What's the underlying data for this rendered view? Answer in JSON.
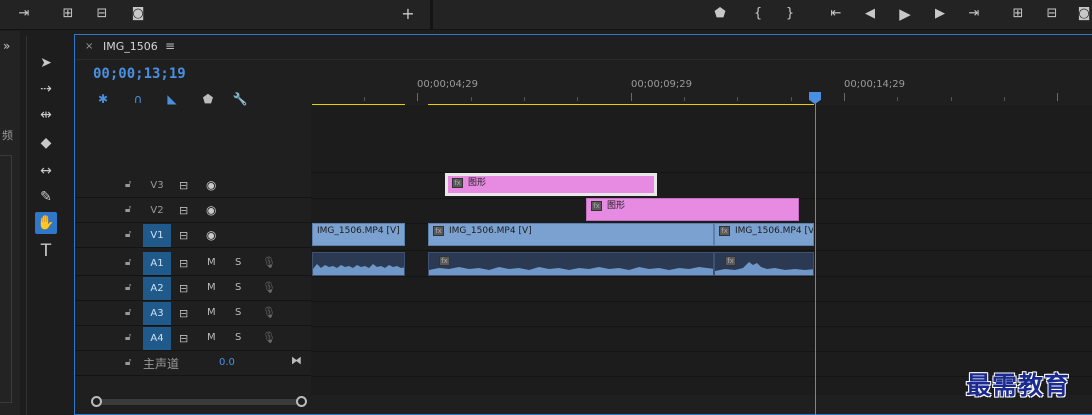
{
  "timeline": {
    "tab_close": "×",
    "sequence_name": "IMG_1506",
    "menu_icon": "≡",
    "timecode": "00;00;13;19"
  },
  "ruler": {
    "labels": [
      "00;00;04;29",
      "00;00;09;29",
      "00;00;14;29"
    ]
  },
  "left_strip": {
    "chevron": "»",
    "fragment": "频"
  },
  "tracks": {
    "video": [
      {
        "name": "V3"
      },
      {
        "name": "V2"
      },
      {
        "name": "V1"
      }
    ],
    "audio": [
      {
        "name": "A1",
        "m": "M",
        "s": "S"
      },
      {
        "name": "A2",
        "m": "M",
        "s": "S"
      },
      {
        "name": "A3",
        "m": "M",
        "s": "S"
      },
      {
        "name": "A4",
        "m": "M",
        "s": "S"
      }
    ],
    "master": {
      "label": "主声道",
      "value": "0.0"
    }
  },
  "clips": {
    "v3_graphic": "图形",
    "v2_graphic": "图形",
    "v1_a": "IMG_1506.MP4 [V]",
    "v1_b": "IMG_1506.MP4 [V]",
    "v1_c": "IMG_1506.MP4 [V]",
    "fx": "fx"
  },
  "colors": {
    "accent": "#2e77c9",
    "timecode": "#4a90e2",
    "video_clip": "#7aa1cf",
    "graphic_clip": "#e68ae2",
    "workarea": "#e6d000"
  },
  "watermark": "最需教育"
}
